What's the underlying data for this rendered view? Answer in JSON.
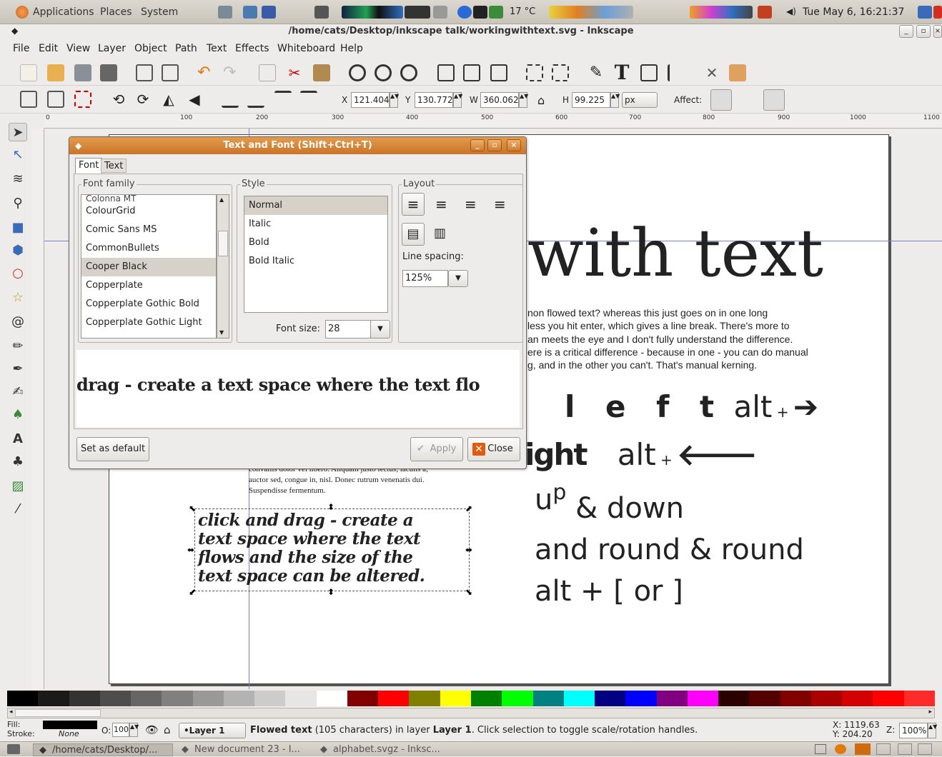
{
  "top_panel": {
    "menus": [
      "Applications",
      "Places",
      "System"
    ],
    "weather": "17 °C",
    "clock": "Tue May  6, 16:21:37"
  },
  "window": {
    "title": "/home/cats/Desktop/inkscape talk/workingwithtext.svg - Inkscape"
  },
  "menu": [
    "File",
    "Edit",
    "View",
    "Layer",
    "Object",
    "Path",
    "Text",
    "Effects",
    "Whiteboard",
    "Help"
  ],
  "toolbar2": {
    "x_label": "X",
    "x_value": "121.404",
    "y_label": "Y",
    "y_value": "130.772",
    "w_label": "W",
    "w_value": "360.062",
    "h_label": "H",
    "h_value": "99.225",
    "unit": "px",
    "affect_label": "Affect:"
  },
  "ruler": [
    "0",
    "100",
    "200",
    "300",
    "400",
    "500",
    "600",
    "700",
    "800",
    "900",
    "1000",
    "1100"
  ],
  "canvas": {
    "heading": "with text",
    "paragraph": [
      "non flowed text? whereas this just goes on in one long",
      "less you hit enter, which gives a line break. There's more to",
      "an meets the eye and I don't fully understand the difference.",
      "ere is a critical difference - because in one - you can do manual",
      "g, and in the other you can't.  That's manual kerning."
    ],
    "left_text": "l e f t",
    "left_shortcut": "alt",
    "right_text": "ight",
    "right_shortcut": "alt",
    "updown_up": "u",
    "updown_p": "p",
    "updown_rest": "& down",
    "round_line": "and round & round",
    "bracket_line": "alt + [ or ]",
    "lorem": [
      "convallis dolor vel libero. Aliquam justo lectus, iaculis a,",
      "auctor sed, congue in, nisl. Donec rutrum venenatis dui.",
      "Suspendisse fermentum."
    ],
    "flowed_text": [
      "click and drag - create a",
      "text space where the text",
      "flows and the size of the",
      "text space can be altered."
    ]
  },
  "dialog": {
    "title": "Text and Font (Shift+Ctrl+T)",
    "tabs": [
      "Font",
      "Text"
    ],
    "font_family_label": "Font family",
    "fonts": [
      "ColourGrid",
      "Comic Sans MS",
      "CommonBullets",
      "Cooper Black",
      "Copperplate",
      "Copperplate Gothic Bold",
      "Copperplate Gothic Light"
    ],
    "style_label": "Style",
    "styles": [
      "Normal",
      "Italic",
      "Bold",
      "Bold Italic"
    ],
    "layout_label": "Layout",
    "line_spacing_label": "Line spacing:",
    "line_spacing_value": "125%",
    "font_size_label": "Font size:",
    "font_size_value": "28",
    "preview": "drag - create a text space where the text flo",
    "set_default": "Set as default",
    "apply": "Apply",
    "close": "Close"
  },
  "status": {
    "fill_label": "Fill:",
    "stroke_label": "Stroke:",
    "stroke_value": "None",
    "opacity_label": "O:",
    "opacity_value": "100",
    "layer": "•Layer 1",
    "message_bold": "Flowed text",
    "message_rest": "(105 characters) in layer",
    "message_layer": "Layer 1",
    "message_tail": ". Click selection to toggle scale/rotation handles.",
    "x_coord": "X: 1119.63",
    "y_coord": "Y:  204.20",
    "zoom_label": "Z:",
    "zoom": "100%"
  },
  "taskbar": [
    "/home/cats/Desktop/...",
    "New document 23 - I...",
    "alphabet.svgz - Inksc..."
  ],
  "colors": {
    "palette": [
      "#000000",
      "#1a1a1a",
      "#333333",
      "#4d4d4d",
      "#666666",
      "#808080",
      "#999999",
      "#b3b3b3",
      "#cccccc",
      "#e6e6e6",
      "#ffffff",
      "#800000",
      "#ff0000",
      "#808000",
      "#ffff00",
      "#008000",
      "#00ff00",
      "#008080",
      "#00ffff",
      "#000080",
      "#0000ff",
      "#800080",
      "#ff00ff",
      "#2b0000",
      "#550000",
      "#800000",
      "#aa0000",
      "#d40000",
      "#ff0000",
      "#ff2a2a"
    ],
    "dialog_title": "#d98537",
    "guide": "#7e7ec9"
  }
}
